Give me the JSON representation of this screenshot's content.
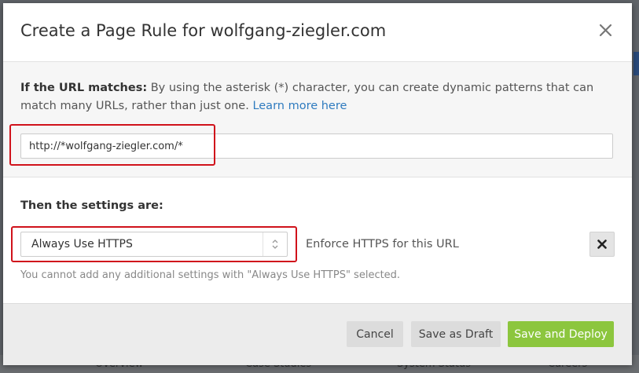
{
  "modal": {
    "title": "Create a Page Rule for wolfgang-ziegler.com"
  },
  "url_section": {
    "label": "If the URL matches:",
    "description": " By using the asterisk (*) character, you can create dynamic patterns that can match many URLs, rather than just one. ",
    "learn_more": "Learn more here",
    "url_value": "http://*wolfgang-ziegler.com/*"
  },
  "settings_section": {
    "heading": "Then the settings are:",
    "setting_selected": "Always Use HTTPS",
    "setting_description": "Enforce HTTPS for this URL",
    "note": "You cannot add any additional settings with \"Always Use HTTPS\" selected."
  },
  "footer": {
    "cancel_label": "Cancel",
    "draft_label": "Save as Draft",
    "deploy_label": "Save and Deploy"
  },
  "background_nav": [
    "Overview",
    "Case Studies",
    "System Status",
    "Careers"
  ],
  "colors": {
    "highlight": "#d0121b",
    "link": "#2f7bbf",
    "deploy_button": "#8cc63e"
  },
  "icons": {
    "close": "close-icon",
    "remove": "remove-x-icon",
    "select_arrows": "updown-arrows-icon"
  }
}
